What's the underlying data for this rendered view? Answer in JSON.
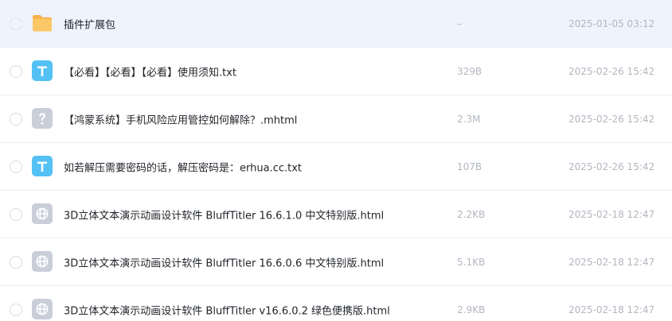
{
  "files": [
    {
      "name": "插件扩展包",
      "size": "–",
      "date": "2025-01-05 03:12",
      "icon": "folder-icon",
      "selected": true
    },
    {
      "name": "【必看】【必看】【必看】使用须知.txt",
      "size": "329B",
      "date": "2025-02-26 15:42",
      "icon": "text-file-icon"
    },
    {
      "name": "【鸿蒙系统】手机风险应用管控如何解除？.mhtml",
      "size": "2.3M",
      "date": "2025-02-26 15:42",
      "icon": "unknown-file-icon"
    },
    {
      "name": "如若解压需要密码的话，解压密码是：erhua.cc.txt",
      "size": "107B",
      "date": "2025-02-26 15:42",
      "icon": "text-file-icon"
    },
    {
      "name": "3D立体文本演示动画设计软件 BluffTitler 16.6.1.0 中文特别版.html",
      "size": "2.2KB",
      "date": "2025-02-18 12:47",
      "icon": "web-file-icon"
    },
    {
      "name": "3D立体文本演示动画设计软件 BluffTitler 16.6.0.6 中文特别版.html",
      "size": "5.1KB",
      "date": "2025-02-18 12:47",
      "icon": "web-file-icon"
    },
    {
      "name": "3D立体文本演示动画设计软件 BluffTitler v16.6.0.2 绿色便携版.html",
      "size": "2.9KB",
      "date": "2025-02-18 12:47",
      "icon": "web-file-icon"
    }
  ],
  "colors": {
    "folder": "#fcc766",
    "text_icon": "#54c1f5",
    "unknown_icon": "#c9ced9",
    "web_icon": "#c9ced9",
    "selected_row": "#eef3fe"
  }
}
